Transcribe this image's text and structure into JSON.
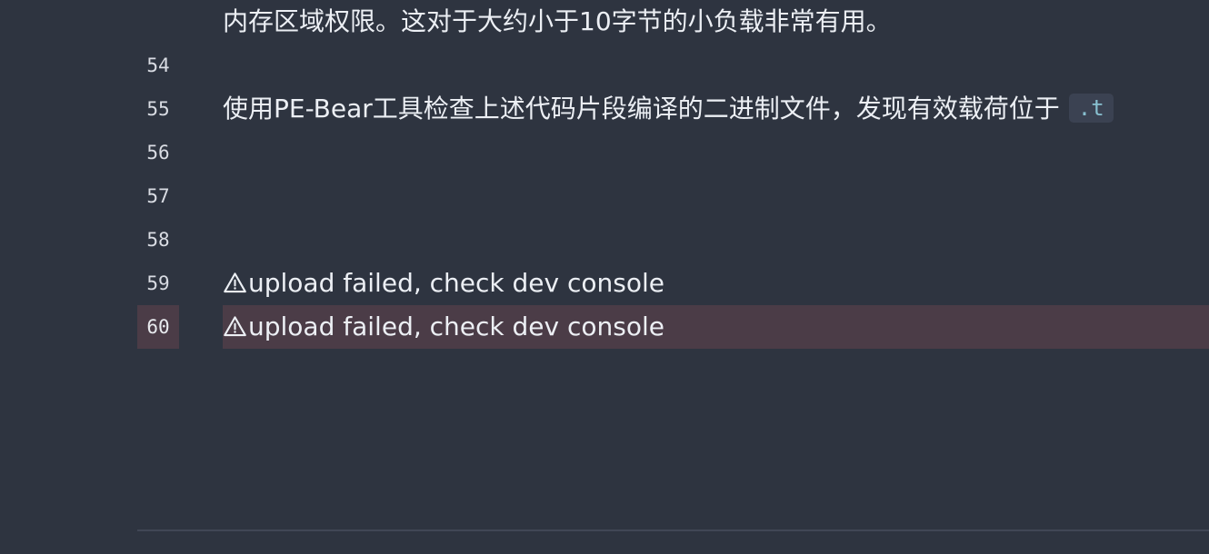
{
  "editor": {
    "lines": [
      {
        "number": "",
        "text": "内存区域权限。这对于大约小于10字节的小负载非常有用。"
      },
      {
        "number": "54",
        "text": ""
      },
      {
        "number": "55",
        "text": "使用PE-Bear工具检查上述代码片段编译的二进制文件，发现有效载荷位于",
        "inline_code": ".t"
      },
      {
        "number": "56",
        "text": ""
      },
      {
        "number": "57",
        "text": ""
      },
      {
        "number": "58",
        "text": ""
      },
      {
        "number": "59",
        "text": "upload failed, check dev console",
        "icon": "warning-icon"
      },
      {
        "number": "60",
        "text": "upload failed, check dev console",
        "icon": "warning-icon",
        "highlighted": true
      }
    ]
  },
  "colors": {
    "background": "#2e3440",
    "highlight": "#4b3c47",
    "text": "#eceff4",
    "gutter_text": "#d9dce3",
    "inline_code_bg": "#3b4252",
    "inline_code_text": "#88c0d0"
  }
}
